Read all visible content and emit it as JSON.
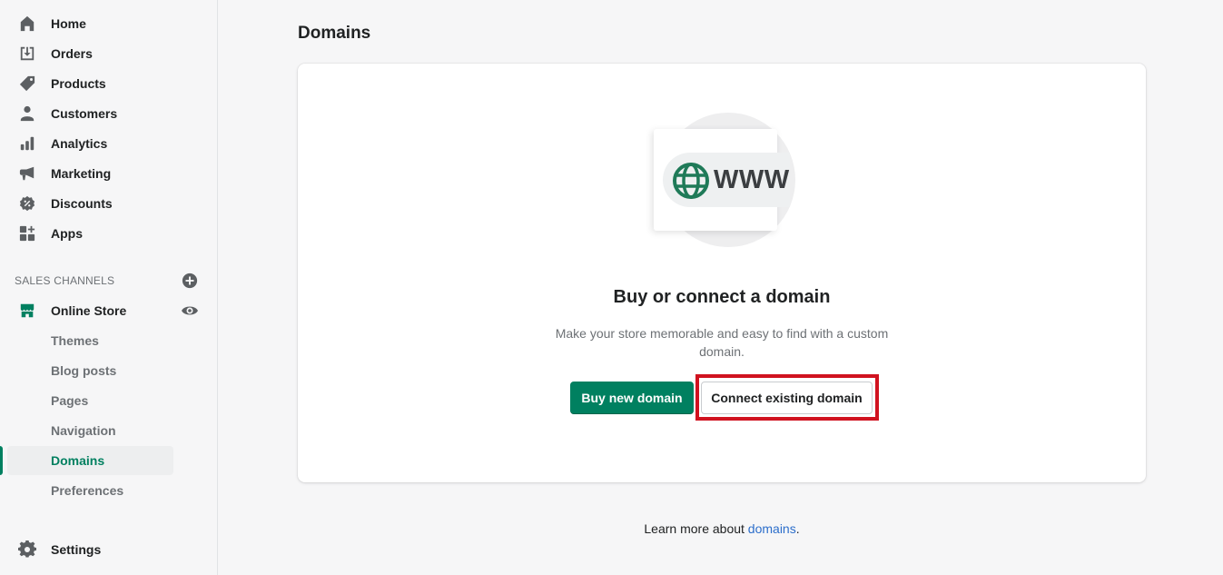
{
  "sidebar": {
    "main_items": [
      {
        "label": "Home",
        "icon": "home-icon"
      },
      {
        "label": "Orders",
        "icon": "orders-icon"
      },
      {
        "label": "Products",
        "icon": "tag-icon"
      },
      {
        "label": "Customers",
        "icon": "person-icon"
      },
      {
        "label": "Analytics",
        "icon": "bar-chart-icon"
      },
      {
        "label": "Marketing",
        "icon": "megaphone-icon"
      },
      {
        "label": "Discounts",
        "icon": "discount-icon"
      },
      {
        "label": "Apps",
        "icon": "apps-icon"
      }
    ],
    "section_title": "SALES CHANNELS",
    "channel": {
      "label": "Online Store",
      "icon": "store-icon"
    },
    "sub_items": [
      {
        "label": "Themes"
      },
      {
        "label": "Blog posts"
      },
      {
        "label": "Pages"
      },
      {
        "label": "Navigation"
      },
      {
        "label": "Domains",
        "active": true
      },
      {
        "label": "Preferences"
      }
    ],
    "settings": {
      "label": "Settings",
      "icon": "gear-icon"
    }
  },
  "page": {
    "title": "Domains"
  },
  "empty_state": {
    "illustration_text": "WWW",
    "heading": "Buy or connect a domain",
    "description": "Make your store memorable and easy to find with a custom domain.",
    "primary_button": "Buy new domain",
    "secondary_button": "Connect existing domain"
  },
  "footer": {
    "prefix": "Learn more about ",
    "link": "domains",
    "suffix": "."
  },
  "colors": {
    "brand_green": "#008060",
    "highlight_red": "#d0121f",
    "link_blue": "#2c6ecb"
  }
}
